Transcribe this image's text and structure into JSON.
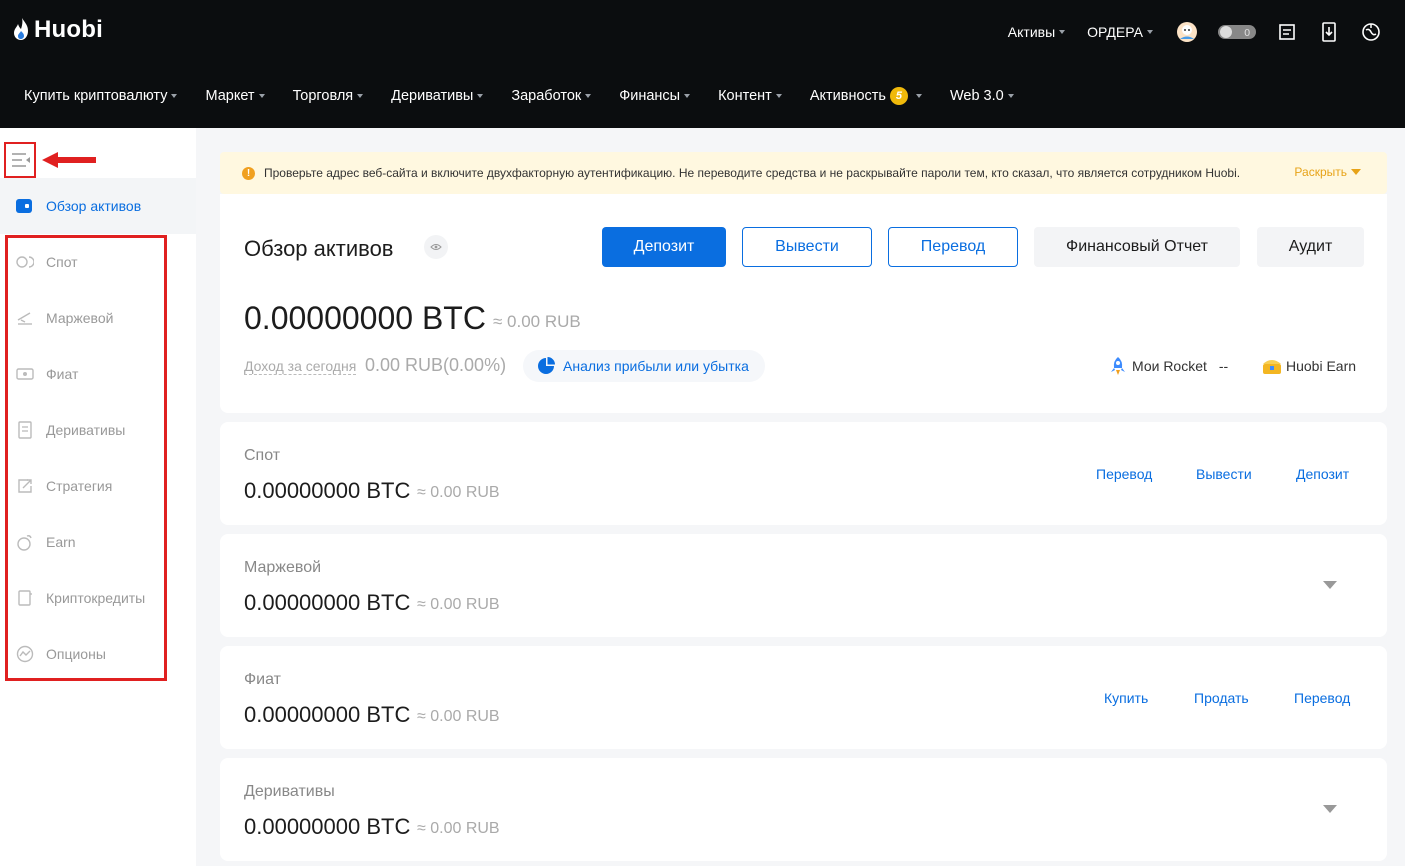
{
  "brand": {
    "name": "Huobi"
  },
  "header": {
    "menus": [
      {
        "label": "Активы"
      },
      {
        "label": "ОРДЕРА"
      }
    ],
    "icons": [
      "avatar",
      "toggle-icon",
      "orders-icon",
      "download-icon",
      "language-icon"
    ]
  },
  "nav": [
    {
      "label": "Купить криптовалюту"
    },
    {
      "label": "Маркет"
    },
    {
      "label": "Торговля"
    },
    {
      "label": "Деривативы"
    },
    {
      "label": "Заработок"
    },
    {
      "label": "Финансы"
    },
    {
      "label": "Контент"
    },
    {
      "label": "Активность",
      "badge": "5"
    },
    {
      "label": "Web 3.0"
    }
  ],
  "sidebar": {
    "active": {
      "label": "Обзор активов"
    },
    "items": [
      {
        "label": "Спот"
      },
      {
        "label": "Маржевой"
      },
      {
        "label": "Фиат"
      },
      {
        "label": "Деривативы"
      },
      {
        "label": "Стратегия"
      },
      {
        "label": "Earn"
      },
      {
        "label": "Криптокредиты"
      },
      {
        "label": "Опционы"
      }
    ]
  },
  "notice": {
    "text": "Проверьте адрес веб-сайта и включите двухфакторную аутентификацию. Не переводите средства и не раскрывайте пароли тем, кто сказал, что является сотрудником Huobi.",
    "expand": "Раскрыть"
  },
  "overview": {
    "title": "Обзор активов",
    "buttons": {
      "deposit": "Депозит",
      "withdraw": "Вывести",
      "transfer": "Перевод",
      "report": "Финансовый Отчет",
      "audit": "Аудит"
    },
    "amount": "0.00000000 BTC",
    "approx": "≈ 0.00 RUB",
    "income_label": "Доход за сегодня",
    "income_value": "0.00 RUB(0.00%)",
    "pl_label": "Анализ прибыли или убытка",
    "rocket_label": "Мои Rocket",
    "rocket_value": "--",
    "earn_label": "Huobi Earn"
  },
  "cards": [
    {
      "title": "Спот",
      "amount": "0.00000000 BTC",
      "approx": "≈ 0.00 RUB",
      "links": [
        "Перевод",
        "Вывести",
        "Депозит"
      ]
    },
    {
      "title": "Маржевой",
      "amount": "0.00000000 BTC",
      "approx": "≈ 0.00 RUB"
    },
    {
      "title": "Фиат",
      "amount": "0.00000000 BTC",
      "approx": "≈ 0.00 RUB",
      "links": [
        "Купить",
        "Продать",
        "Перевод"
      ]
    },
    {
      "title": "Деривативы",
      "amount": "0.00000000 BTC",
      "approx": "≈ 0.00 RUB"
    }
  ],
  "colors": {
    "accent": "#0a6ee0",
    "header_bg": "#0b0d0f",
    "highlight": "#e02020",
    "notice_bg": "#fff8e0"
  }
}
